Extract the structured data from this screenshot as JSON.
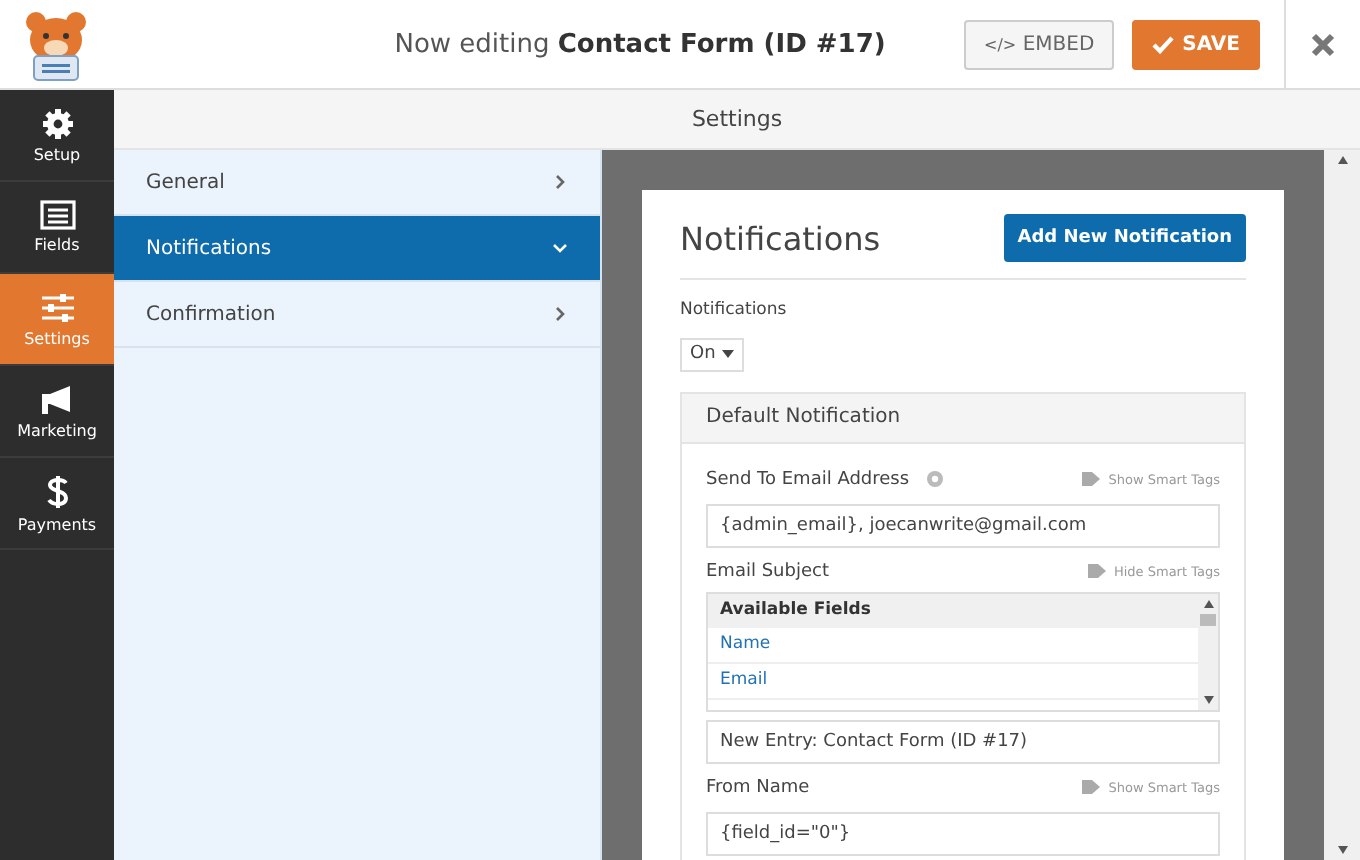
{
  "header": {
    "title_prefix": "Now editing",
    "title_form": "Contact Form (ID #17)",
    "embed_button": {
      "icon": "</>",
      "label": "EMBED"
    },
    "save_button": {
      "label": "SAVE"
    }
  },
  "sidebar": {
    "items": [
      {
        "label": "Setup",
        "selected": false
      },
      {
        "label": "Fields",
        "selected": false
      },
      {
        "label": "Settings",
        "selected": true
      },
      {
        "label": "Marketing",
        "selected": false
      },
      {
        "label": "Payments",
        "selected": false
      }
    ]
  },
  "section_bar": {
    "title": "Settings"
  },
  "settings_menu": {
    "items": [
      {
        "label": "General",
        "selected": false
      },
      {
        "label": "Notifications",
        "selected": true
      },
      {
        "label": "Confirmation",
        "selected": false
      }
    ]
  },
  "panel": {
    "title": "Notifications",
    "add_button": "Add New Notification",
    "toggle": {
      "label": "Notifications",
      "value": "On"
    },
    "notification": {
      "title": "Default Notification",
      "fields": [
        {
          "kind": "text",
          "label": "Send To Email Address",
          "help": true,
          "tags_link": "Show Smart Tags",
          "value": "{admin_email}, joecanwrite@gmail.com"
        },
        {
          "kind": "text",
          "label": "Email Subject",
          "help": false,
          "tags_link": "Hide Smart Tags",
          "value": "New Entry: Contact Form (ID #17)",
          "tags": {
            "heading": "Available Fields",
            "items": [
              "Name",
              "Email"
            ]
          }
        },
        {
          "kind": "text",
          "label": "From Name",
          "help": false,
          "tags_link": "Show Smart Tags",
          "value": "{field_id=\"0\"}"
        }
      ]
    }
  }
}
